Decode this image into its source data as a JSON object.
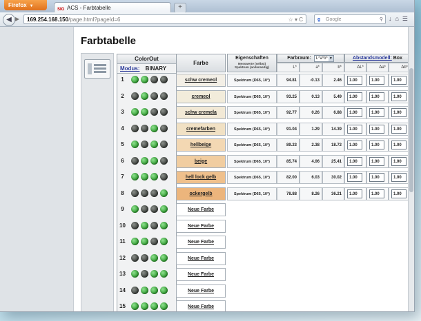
{
  "browser": {
    "app_button": "Firefox",
    "tab_title": "ACS - Farbtabelle",
    "url_host": "169.254.168.150",
    "url_path": "/page.html?pageId=6",
    "search_placeholder": "Google"
  },
  "page": {
    "title": "Farbtabelle"
  },
  "colorout": {
    "header": "ColorOut",
    "modus_label": "Modus:",
    "modus_value": "BINARY",
    "rows": [
      {
        "num": "1",
        "leds": [
          1,
          1,
          0,
          0
        ]
      },
      {
        "num": "2",
        "leds": [
          0,
          1,
          0,
          0
        ]
      },
      {
        "num": "3",
        "leds": [
          1,
          1,
          0,
          0
        ]
      },
      {
        "num": "4",
        "leds": [
          0,
          0,
          1,
          0
        ]
      },
      {
        "num": "5",
        "leds": [
          1,
          0,
          1,
          0
        ]
      },
      {
        "num": "6",
        "leds": [
          0,
          1,
          1,
          0
        ]
      },
      {
        "num": "7",
        "leds": [
          1,
          1,
          1,
          0
        ]
      },
      {
        "num": "8",
        "leds": [
          0,
          0,
          0,
          1
        ]
      },
      {
        "num": "9",
        "leds": [
          1,
          0,
          0,
          1
        ]
      },
      {
        "num": "10",
        "leds": [
          0,
          1,
          0,
          1
        ]
      },
      {
        "num": "11",
        "leds": [
          1,
          1,
          0,
          1
        ]
      },
      {
        "num": "12",
        "leds": [
          0,
          0,
          1,
          1
        ]
      },
      {
        "num": "13",
        "leds": [
          1,
          0,
          1,
          1
        ]
      },
      {
        "num": "14",
        "leds": [
          0,
          1,
          1,
          1
        ]
      },
      {
        "num": "15",
        "leds": [
          1,
          1,
          1,
          1
        ]
      }
    ]
  },
  "table": {
    "col_farbe": "Farbe",
    "col_eigenschaften": "Eigenschaften",
    "eig_sub1": "Messwerte (selbst)",
    "eig_sub2": "Spektrum (anderweitig)",
    "col_farbraum": "Farbraum:",
    "farbraum_value": "L*a*b*",
    "col_abstand": "Abstandsmodell:",
    "abstand_value": "Box",
    "sub_L": "L*",
    "sub_a": "a*",
    "sub_b": "b*",
    "sub_dL": "ΔL*",
    "sub_da": "Δa*",
    "sub_db": "Δb*",
    "new_color": "Neue Farbe",
    "colors": [
      {
        "name": "schw cremeol",
        "spec": "Spektrum (D65, 10°)",
        "L": "94.81",
        "a": "-0.13",
        "b": "2.46",
        "dL": "1.00",
        "da": "1.00",
        "db": "1.00",
        "bg": "#f3efe6"
      },
      {
        "name": "cremeol",
        "spec": "Spektrum (D65, 10°)",
        "L": "93.25",
        "a": "0.13",
        "b": "5.49",
        "dL": "1.00",
        "da": "1.00",
        "db": "1.00",
        "bg": "#f2ecdb"
      },
      {
        "name": "schw cremela",
        "spec": "Spektrum (D65, 10°)",
        "L": "92.77",
        "a": "0.26",
        "b": "6.88",
        "dL": "1.00",
        "da": "1.00",
        "db": "1.00",
        "bg": "#f2e9d6"
      },
      {
        "name": "cremefarben",
        "spec": "Spektrum (D65, 10°)",
        "L": "91.04",
        "a": "1.29",
        "b": "14.39",
        "dL": "1.00",
        "da": "1.00",
        "db": "1.00",
        "bg": "#f1e1c4"
      },
      {
        "name": "hellbeige",
        "spec": "Spektrum (D65, 10°)",
        "L": "89.23",
        "a": "2.38",
        "b": "18.72",
        "dL": "1.00",
        "da": "1.00",
        "db": "1.00",
        "bg": "#f3d8b3"
      },
      {
        "name": "beige",
        "spec": "Spektrum (D65, 10°)",
        "L": "85.74",
        "a": "4.06",
        "b": "25.41",
        "dL": "1.00",
        "da": "1.00",
        "db": "1.00",
        "bg": "#f1cda0"
      },
      {
        "name": "hell lock gelb",
        "spec": "Spektrum (D65, 10°)",
        "L": "82.00",
        "a": "6.03",
        "b": "30.02",
        "dL": "1.00",
        "da": "1.00",
        "db": "1.00",
        "bg": "#efc08c"
      },
      {
        "name": "ockergelb",
        "spec": "Spektrum (D65, 10°)",
        "L": "78.88",
        "a": "8.26",
        "b": "36.21",
        "dL": "1.00",
        "da": "1.00",
        "db": "1.00",
        "bg": "#ecb57c"
      }
    ],
    "new_rows": 7
  }
}
